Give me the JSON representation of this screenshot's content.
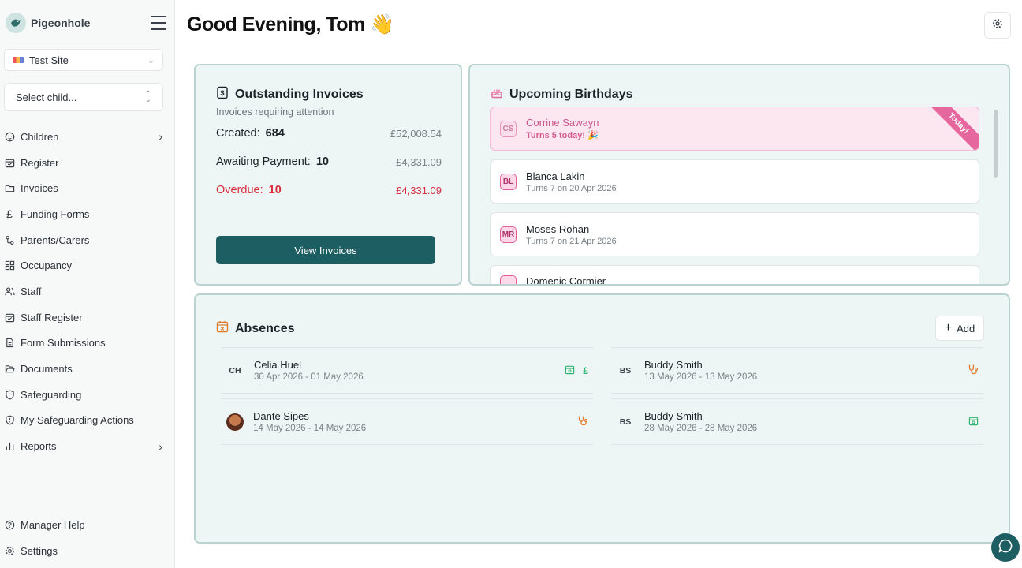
{
  "app": {
    "name": "Pigeonhole"
  },
  "sidebar": {
    "site_select": {
      "value": "Test Site"
    },
    "child_select": {
      "placeholder": "Select child..."
    },
    "items": [
      {
        "label": "Children",
        "icon": "child-face-icon",
        "has_arrow": true
      },
      {
        "label": "Register",
        "icon": "calendar-check-icon"
      },
      {
        "label": "Invoices",
        "icon": "folder-icon"
      },
      {
        "label": "Funding Forms",
        "icon": "pound-icon"
      },
      {
        "label": "Parents/Carers",
        "icon": "people-link-icon"
      },
      {
        "label": "Occupancy",
        "icon": "grid-icon"
      },
      {
        "label": "Staff",
        "icon": "users-icon"
      },
      {
        "label": "Staff Register",
        "icon": "calendar-check-icon"
      },
      {
        "label": "Form Submissions",
        "icon": "document-icon"
      },
      {
        "label": "Documents",
        "icon": "folder-open-icon"
      },
      {
        "label": "Safeguarding",
        "icon": "shield-icon"
      },
      {
        "label": "My Safeguarding Actions",
        "icon": "shield-alert-icon"
      },
      {
        "label": "Reports",
        "icon": "bar-chart-icon",
        "has_arrow": true
      }
    ],
    "bottom_items": [
      {
        "label": "Manager Help",
        "icon": "help-circle-icon"
      },
      {
        "label": "Settings",
        "icon": "gear-icon"
      }
    ]
  },
  "header": {
    "greeting": "Good Evening, Tom",
    "emoji": "👋"
  },
  "invoices": {
    "title": "Outstanding Invoices",
    "subtitle": "Invoices requiring attention",
    "rows": [
      {
        "label": "Created:",
        "count": "684",
        "amount": "£52,008.54"
      },
      {
        "label": "Awaiting Payment:",
        "count": "10",
        "amount": "£4,331.09"
      },
      {
        "label": "Overdue:",
        "count": "10",
        "amount": "£4,331.09"
      }
    ],
    "button": "View Invoices"
  },
  "birthdays": {
    "title": "Upcoming Birthdays",
    "items": [
      {
        "initials": "CS",
        "name": "Corrine Sawayn",
        "sub": "Turns 5 today! 🎉",
        "ribbon": "Today!"
      },
      {
        "initials": "BL",
        "name": "Blanca Lakin",
        "sub": "Turns 7 on 20 Apr 2026"
      },
      {
        "initials": "MR",
        "name": "Moses Rohan",
        "sub": "Turns 7 on 21 Apr 2026"
      },
      {
        "initials": "",
        "name": "Domenic Cormier",
        "sub": ""
      }
    ]
  },
  "absences": {
    "title": "Absences",
    "add_label": "Add",
    "left": [
      {
        "initials": "CH",
        "name": "Celia Huel",
        "dates": "30 Apr 2026 - 01 May 2026",
        "icons": [
          "holiday-calendar-icon",
          "pound-icon"
        ]
      },
      {
        "initials": "",
        "photo": true,
        "name": "Dante Sipes",
        "dates": "14 May 2026 - 14 May 2026",
        "icons": [
          "stethoscope-icon"
        ]
      }
    ],
    "right": [
      {
        "initials": "BS",
        "name": "Buddy Smith",
        "dates": "13 May 2026 - 13 May 2026",
        "icons": [
          "stethoscope-icon"
        ]
      },
      {
        "initials": "BS",
        "name": "Buddy Smith",
        "dates": "28 May 2026 - 28 May 2026",
        "icons": [
          "holiday-calendar-icon"
        ]
      }
    ]
  },
  "colors": {
    "brand": "#1d5e63",
    "overdue": "#d7313f",
    "birthday": "#e6679d",
    "sick": "#e07b2a",
    "holiday": "#2fb56f"
  }
}
